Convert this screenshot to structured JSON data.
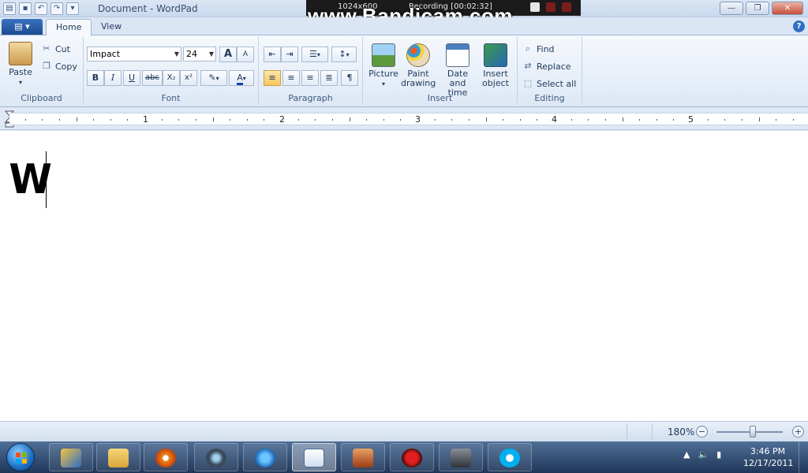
{
  "window": {
    "title": "Document - WordPad",
    "controls": {
      "minimize": "—",
      "maximize": "❐",
      "close": "✕"
    }
  },
  "bandicam": {
    "watermark": "www.Bandicam.com",
    "resolution": "1024x600",
    "recording": "Recording [00:02:32]"
  },
  "tabs": {
    "app_menu": "▤ ▾",
    "home": "Home",
    "view": "View",
    "help": "?"
  },
  "clipboard": {
    "label": "Clipboard",
    "paste": "Paste",
    "cut": "Cut",
    "copy": "Copy"
  },
  "font": {
    "label": "Font",
    "family": "Impact",
    "size": "24",
    "grow": "A",
    "shrink": "A",
    "bold": "B",
    "italic": "I",
    "underline": "U",
    "strikethrough": "abc",
    "subscript": "X₂",
    "superscript": "x²",
    "text_color": "A"
  },
  "paragraph": {
    "label": "Paragraph"
  },
  "insert": {
    "label": "Insert",
    "picture": "Picture",
    "paint_line1": "Paint",
    "paint_line2": "drawing",
    "date_line1": "Date and",
    "date_line2": "time",
    "object_line1": "Insert",
    "object_line2": "object"
  },
  "editing": {
    "label": "Editing",
    "find": "Find",
    "replace": "Replace",
    "select_all": "Select all"
  },
  "ruler": {
    "numbers": [
      "1",
      "2",
      "3",
      "4",
      "5"
    ]
  },
  "document": {
    "text": "W"
  },
  "status": {
    "zoom": "180%",
    "zoom_out": "−",
    "zoom_in": "+",
    "zoom_fraction": 0.55
  },
  "taskbar": {
    "time": "3:46 PM",
    "date": "12/17/2011"
  },
  "colors": {
    "accent": "#1c4b90",
    "active_button": "#f8c55d",
    "taskbar": "#1f3658"
  }
}
